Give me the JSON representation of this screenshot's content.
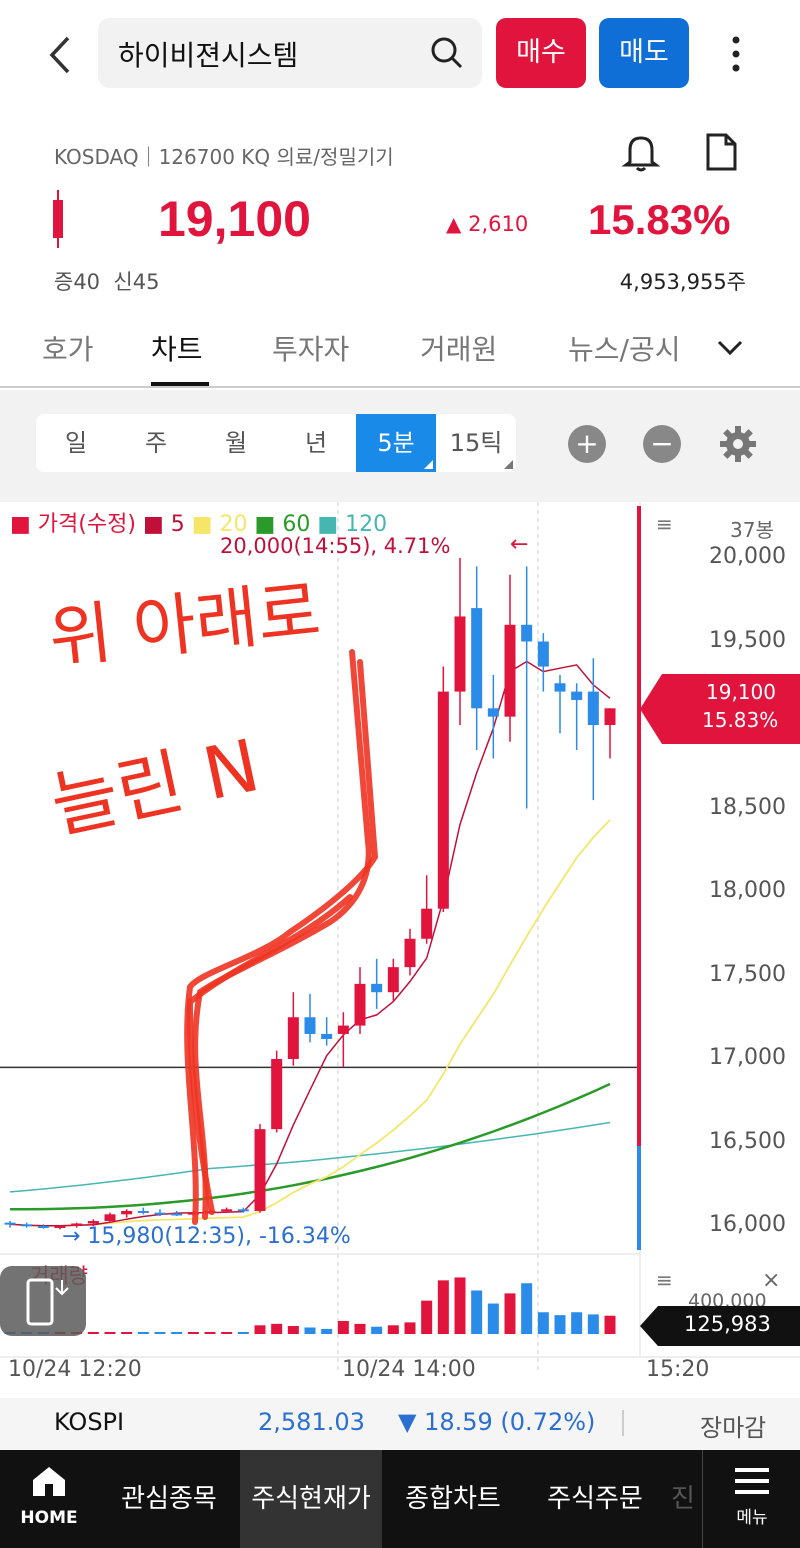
{
  "header": {
    "search_text": "하이비젼시스템",
    "buy_label": "매수",
    "sell_label": "매도"
  },
  "stock": {
    "meta": "KOSDAQ｜126700 KQ 의료/정밀기기",
    "price": "19,100",
    "change": "2,610",
    "change_pct": "15.83%",
    "margin_info": "증40  신45",
    "volume": "4,953,955주"
  },
  "tabs": [
    "호가",
    "차트",
    "투자자",
    "거래원",
    "뉴스/공시"
  ],
  "periods": [
    "일",
    "주",
    "월",
    "년",
    "5분",
    "15틱"
  ],
  "chart": {
    "legend": {
      "price": "가격(수정)",
      "ma5": "5",
      "ma20": "20",
      "ma60": "60",
      "ma120": "120"
    },
    "bars_label": "37봉",
    "high_note": "20,000(14:55), 4.71%",
    "high_arrow": "←",
    "low_note": "→ 15,980(12:35), -16.34%",
    "current_price": "19,100",
    "current_pct": "15.83%",
    "yticks": [
      "20,000",
      "19,500",
      "18,500",
      "18,000",
      "17,500",
      "17,000",
      "16,500",
      "16,000"
    ],
    "volume_label": "거래량",
    "volume_tick": "400,000",
    "volume_current": "125,983",
    "xticks": [
      "10/24 12:20",
      "10/24 14:00",
      "15:20"
    ],
    "handwriting": "위 아래로 늘린 N",
    "colors": {
      "up": "#e0143c",
      "down": "#2b8be8",
      "ma5": "#c0103a",
      "ma20": "#f5e66a",
      "ma60": "#2a9a2a",
      "ma120": "#46b7b0"
    }
  },
  "chart_data": {
    "type": "candlestick",
    "x_range": [
      "10/24 12:20",
      "10/24 15:20"
    ],
    "ylim": [
      15900,
      20100
    ],
    "candles": [
      {
        "o": 16020,
        "h": 16030,
        "l": 15990,
        "c": 16010
      },
      {
        "o": 16010,
        "h": 16020,
        "l": 15990,
        "c": 16000
      },
      {
        "o": 16000,
        "h": 16010,
        "l": 15985,
        "c": 15995
      },
      {
        "o": 15995,
        "h": 16005,
        "l": 15980,
        "c": 16000
      },
      {
        "o": 16000,
        "h": 16020,
        "l": 15990,
        "c": 16015
      },
      {
        "o": 16015,
        "h": 16040,
        "l": 16000,
        "c": 16030
      },
      {
        "o": 16030,
        "h": 16080,
        "l": 16020,
        "c": 16070
      },
      {
        "o": 16070,
        "h": 16100,
        "l": 16050,
        "c": 16090
      },
      {
        "o": 16090,
        "h": 16110,
        "l": 16070,
        "c": 16080
      },
      {
        "o": 16080,
        "h": 16100,
        "l": 16060,
        "c": 16075
      },
      {
        "o": 16075,
        "h": 16090,
        "l": 16060,
        "c": 16070
      },
      {
        "o": 16070,
        "h": 16090,
        "l": 16060,
        "c": 16080
      },
      {
        "o": 16080,
        "h": 16100,
        "l": 16070,
        "c": 16090
      },
      {
        "o": 16090,
        "h": 16110,
        "l": 16080,
        "c": 16100
      },
      {
        "o": 16100,
        "h": 16110,
        "l": 16080,
        "c": 16090
      },
      {
        "o": 16090,
        "h": 16610,
        "l": 16080,
        "c": 16580
      },
      {
        "o": 16580,
        "h": 17050,
        "l": 16560,
        "c": 17000
      },
      {
        "o": 17000,
        "h": 17400,
        "l": 16960,
        "c": 17250
      },
      {
        "o": 17250,
        "h": 17390,
        "l": 17100,
        "c": 17150
      },
      {
        "o": 17150,
        "h": 17250,
        "l": 17080,
        "c": 17120
      },
      {
        "o": 17150,
        "h": 17280,
        "l": 16950,
        "c": 17200
      },
      {
        "o": 17200,
        "h": 17550,
        "l": 17150,
        "c": 17450
      },
      {
        "o": 17450,
        "h": 17600,
        "l": 17300,
        "c": 17400
      },
      {
        "o": 17400,
        "h": 17600,
        "l": 17350,
        "c": 17550
      },
      {
        "o": 17550,
        "h": 17780,
        "l": 17500,
        "c": 17720
      },
      {
        "o": 17720,
        "h": 18100,
        "l": 17690,
        "c": 17900
      },
      {
        "o": 17900,
        "h": 19350,
        "l": 17880,
        "c": 19200
      },
      {
        "o": 19200,
        "h": 20000,
        "l": 19000,
        "c": 19650
      },
      {
        "o": 19700,
        "h": 19950,
        "l": 18850,
        "c": 19100
      },
      {
        "o": 19100,
        "h": 19300,
        "l": 18800,
        "c": 19050
      },
      {
        "o": 19050,
        "h": 19900,
        "l": 18900,
        "c": 19600
      },
      {
        "o": 19600,
        "h": 19950,
        "l": 18500,
        "c": 19500
      },
      {
        "o": 19500,
        "h": 19550,
        "l": 19200,
        "c": 19350
      },
      {
        "o": 19250,
        "h": 19300,
        "l": 18950,
        "c": 19200
      },
      {
        "o": 19200,
        "h": 19250,
        "l": 18850,
        "c": 19150
      },
      {
        "o": 19200,
        "h": 19400,
        "l": 18550,
        "c": 19000
      },
      {
        "o": 19000,
        "h": 19100,
        "l": 18800,
        "c": 19100
      }
    ],
    "volume": [
      8000,
      7000,
      6000,
      6500,
      9000,
      8000,
      10000,
      9000,
      8000,
      7500,
      7000,
      7200,
      8000,
      9000,
      8000,
      60000,
      70000,
      55000,
      45000,
      35000,
      90000,
      70000,
      50000,
      60000,
      80000,
      230000,
      370000,
      390000,
      300000,
      210000,
      280000,
      350000,
      150000,
      130000,
      150000,
      135000,
      125983
    ]
  },
  "index_bar": {
    "name": "KOSPI",
    "value": "2,581.03",
    "change": "▼ 18.59 (0.72%)",
    "status": "장마감"
  },
  "nav": {
    "home_label": "HOME",
    "items": [
      "관심종목",
      "주식현재가",
      "종합차트",
      "주식주문",
      "진"
    ],
    "menu_label": "메뉴"
  }
}
